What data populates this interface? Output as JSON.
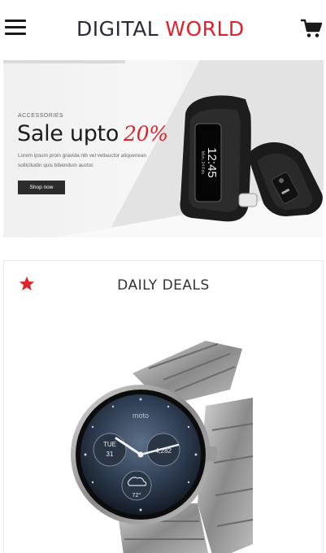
{
  "header": {
    "menu_icon": "hamburger-menu-icon",
    "logo_part1": "DIGITAL",
    "logo_part2": "WORLD",
    "cart_icon": "shopping-cart-icon"
  },
  "banner": {
    "eyebrow": "ACCESSORIES",
    "title": "Sale upto",
    "percent": "20%",
    "description": "Lorem ipsum proin gravida nlb vel vellauctor aliquenean sollicitudin quis bibendum auctor.",
    "button_label": "Shop now",
    "band_time": "12:45",
    "band_date": "Mon, 24 Feb"
  },
  "deals": {
    "title": "DAILY DEALS",
    "star_icon": "star-icon",
    "watch_brand": "moto",
    "watch_day": "TUE",
    "watch_date": "31",
    "watch_steps": "4,282",
    "watch_temp": "72°"
  },
  "colors": {
    "accent": "#e0212a",
    "dark": "#2a2a3a",
    "button": "#2c2c2c"
  }
}
